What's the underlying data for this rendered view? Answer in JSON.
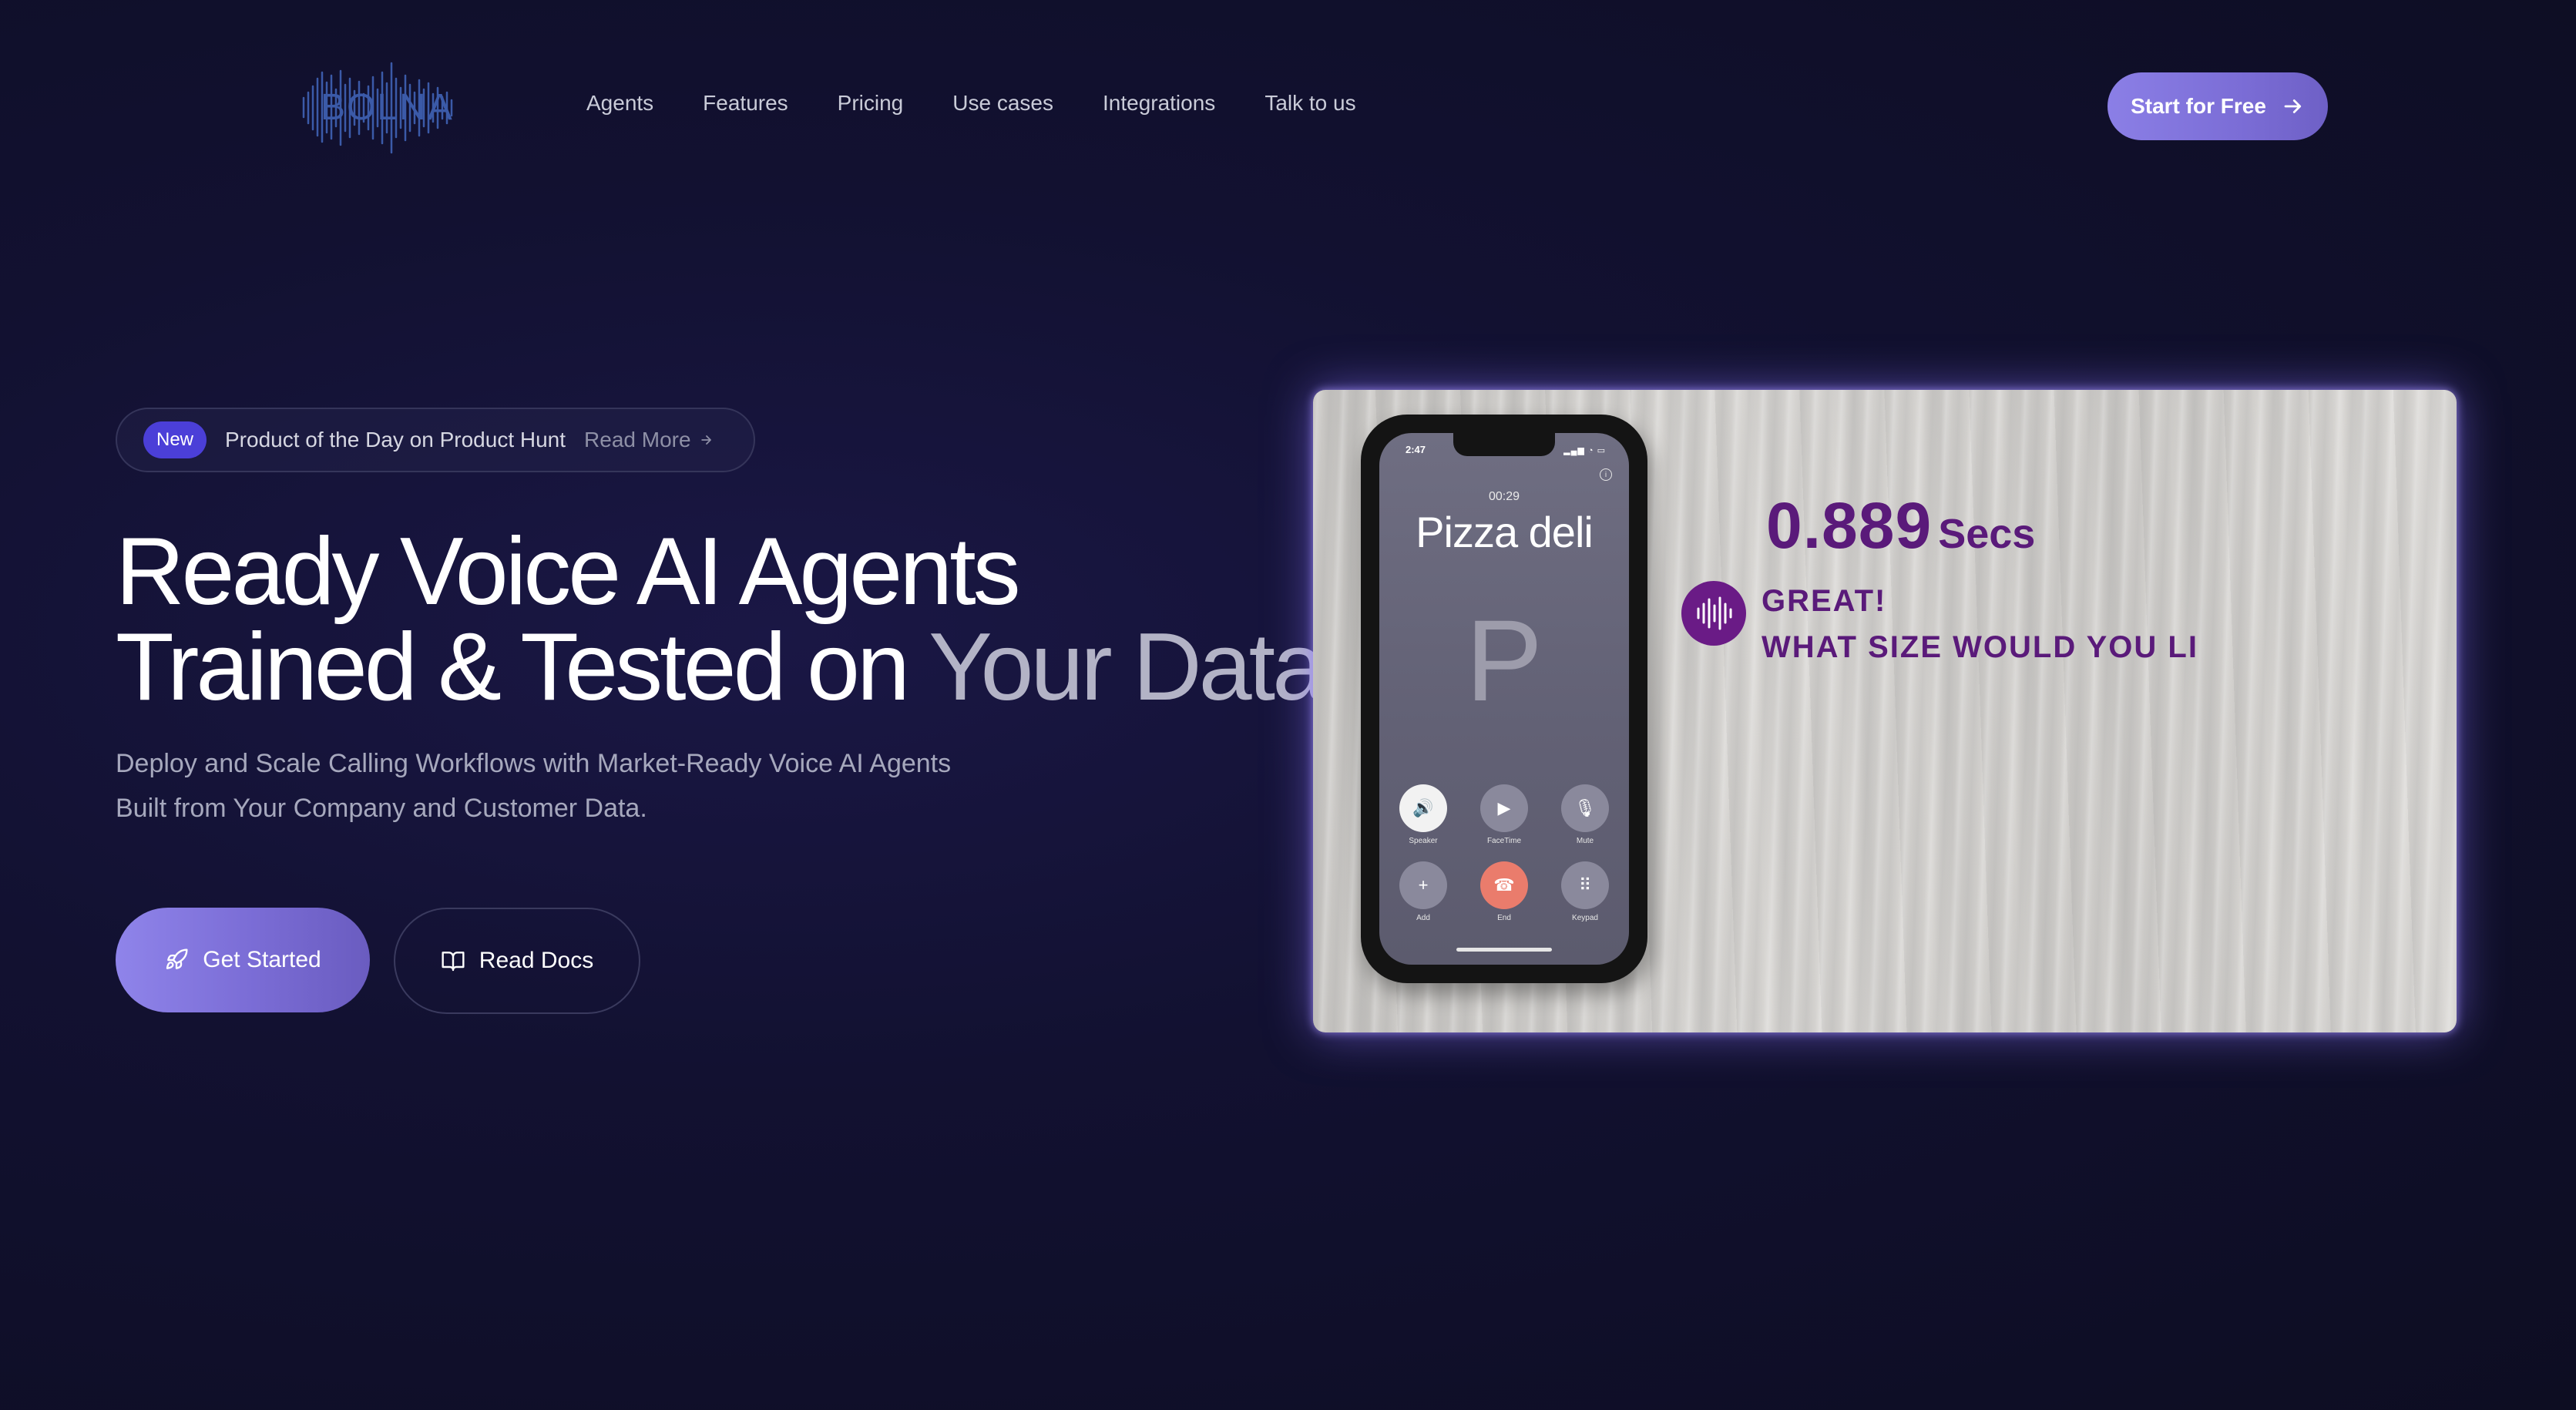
{
  "nav": {
    "logo_text": "BOLNA",
    "links": [
      "Agents",
      "Features",
      "Pricing",
      "Use cases",
      "Integrations",
      "Talk to us"
    ],
    "cta_label": "Start for Free"
  },
  "badge": {
    "tag": "New",
    "text": "Product of the Day on Product Hunt",
    "link_label": "Read More"
  },
  "hero": {
    "headline_line1": "Ready Voice AI Agents",
    "headline_line2_a": "Trained & Tested on ",
    "headline_line2_b": "Your Data",
    "subtitle_line1": "Deploy and Scale Calling Workflows with Market-Ready Voice AI Agents",
    "subtitle_line2": "Built from Your Company and Customer Data.",
    "primary_button": "Get Started",
    "secondary_button": "Read Docs"
  },
  "video": {
    "status_time": "2:47",
    "call_timer": "00:29",
    "caller_name": "Pizza deli",
    "caller_initial": "P",
    "call_buttons": [
      {
        "label": "Speaker"
      },
      {
        "label": "FaceTime"
      },
      {
        "label": "Mute"
      },
      {
        "label": "Add"
      },
      {
        "label": "End"
      },
      {
        "label": "Keypad"
      }
    ],
    "latency_value": "0.889",
    "latency_unit": "Secs",
    "transcript_line1": "GREAT!",
    "transcript_line2": "WHAT SIZE WOULD YOU LI"
  },
  "colors": {
    "background": "#121131",
    "accent": "#8b7fe6",
    "badge_new": "#4b3fd8",
    "overlay_text": "#5a1a7a"
  }
}
